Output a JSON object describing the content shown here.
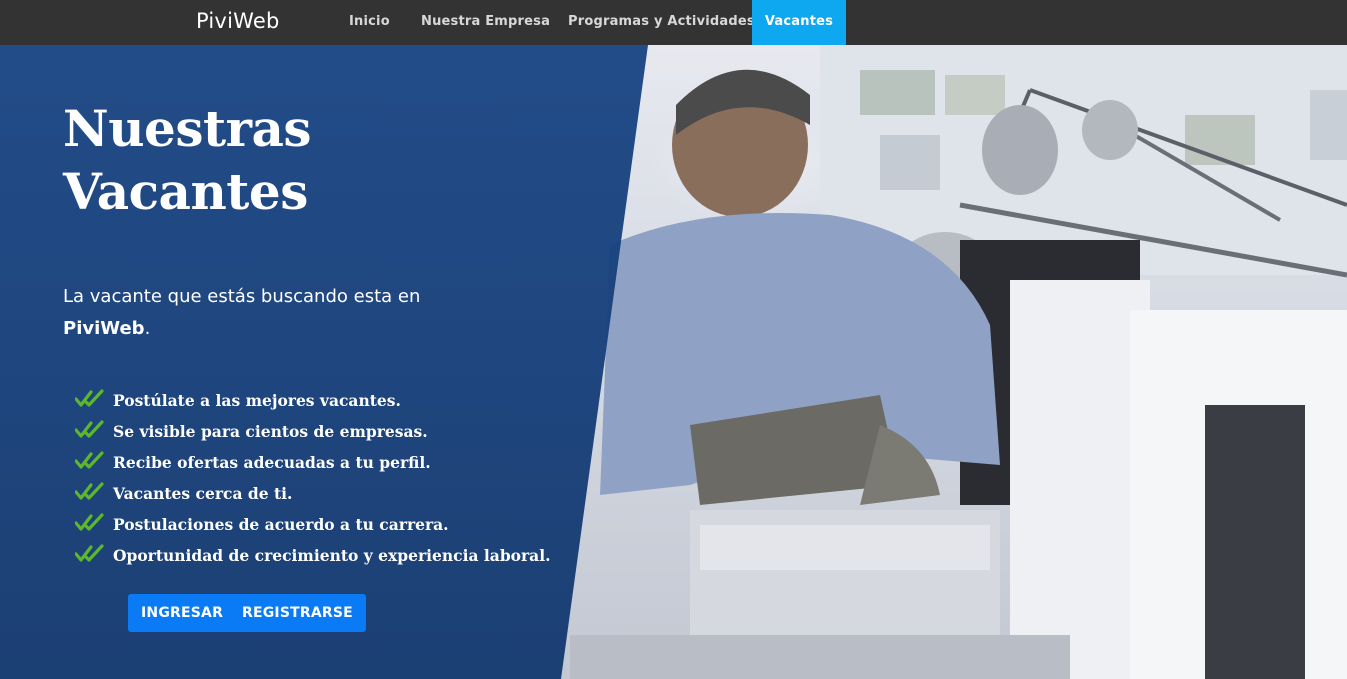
{
  "navbar": {
    "brand": "PiviWeb",
    "links": [
      {
        "label": "Inicio"
      },
      {
        "label": "Nuestra Empresa"
      },
      {
        "label": "Programas y Actividades"
      },
      {
        "label": "Vacantes",
        "active": true
      }
    ]
  },
  "hero": {
    "title_line1": "Nuestras",
    "title_line2": "Vacantes",
    "subtitle_pre": "La vacante que estás buscando esta en",
    "subtitle_brand": "PiviWeb",
    "subtitle_post": ".",
    "features": [
      {
        "icon": "double-check-icon",
        "text": "Postúlate a las mejores vacantes."
      },
      {
        "icon": "double-check-icon",
        "text": "Se visible para cientos de empresas."
      },
      {
        "icon": "double-check-icon",
        "text": "Recibe ofertas adecuadas a tu perfil."
      },
      {
        "icon": "double-check-icon",
        "text": "Vacantes cerca de ti."
      },
      {
        "icon": "double-check-icon",
        "text": "Postulaciones de acuerdo a tu carrera."
      },
      {
        "icon": "double-check-icon",
        "text": "Oportunidad de crecimiento y experiencia laboral."
      }
    ],
    "buttons": {
      "primary": "INGRESAR",
      "secondary": "REGISTRARSE"
    }
  },
  "colors": {
    "navbar_bg": "#333333",
    "active_tab": "#0ea8f0",
    "panel_blue": "#1a4684",
    "button_blue": "#0b7bf5",
    "check_green": "#5cb82a"
  }
}
